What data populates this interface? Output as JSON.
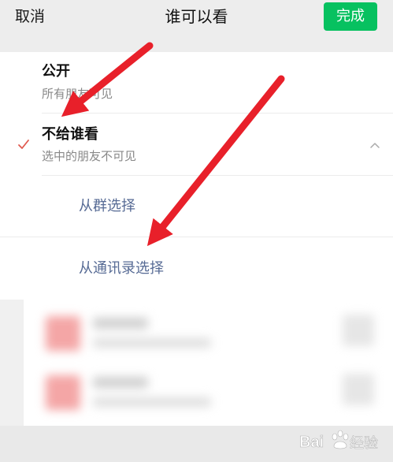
{
  "header": {
    "cancel_label": "取消",
    "title": "谁可以看",
    "done_label": "完成"
  },
  "options": [
    {
      "title": "公开",
      "subtitle": "所有朋友可见"
    },
    {
      "title": "不给谁看",
      "subtitle": "选中的朋友不可见",
      "selected": true
    }
  ],
  "sub_options": [
    {
      "label": "从群选择"
    },
    {
      "label": "从通讯录选择"
    }
  ],
  "colors": {
    "accent_green": "#07c160",
    "link_blue": "#576b95",
    "check_red": "#e05a4f",
    "arrow_red": "#e8202a"
  },
  "watermark": {
    "text": "Bai经验"
  }
}
